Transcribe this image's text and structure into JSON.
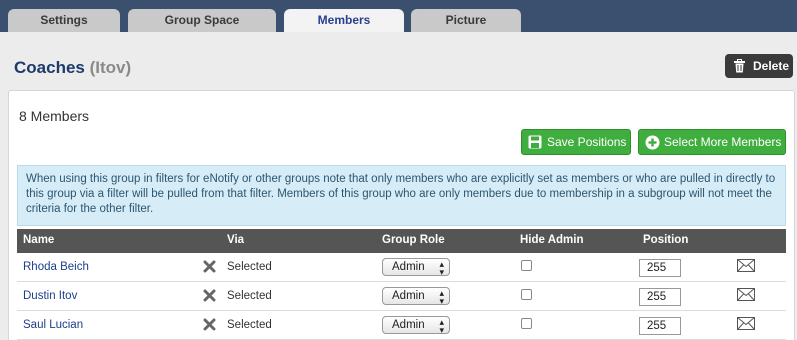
{
  "tabs": [
    {
      "label": "Settings",
      "active": false
    },
    {
      "label": "Group Space",
      "active": false
    },
    {
      "label": "Members",
      "active": true
    },
    {
      "label": "Picture",
      "active": false
    }
  ],
  "header": {
    "title": "Coaches",
    "subtitle": "(Itov)",
    "delete_label": "Delete"
  },
  "panel": {
    "members_count": "8 Members",
    "save_positions_label": "Save Positions",
    "select_more_label": "Select More Members",
    "info_text": "When using this group in filters for eNotify or other groups note that only members who are explicitly set as members or who are pulled in directly to this group via a filter will be pulled from that filter. Members of this group who are only members due to membership in a subgroup will not meet the criteria for the other filter."
  },
  "table": {
    "columns": [
      "Name",
      "Via",
      "Group Role",
      "Hide Admin",
      "Position"
    ],
    "rows": [
      {
        "name": "Rhoda Beich",
        "via": "Selected",
        "role": "Admin",
        "hide_admin": false,
        "position": "255"
      },
      {
        "name": "Dustin Itov",
        "via": "Selected",
        "role": "Admin",
        "hide_admin": false,
        "position": "255"
      },
      {
        "name": "Saul Lucian",
        "via": "Selected",
        "role": "Admin",
        "hide_admin": false,
        "position": "255"
      }
    ]
  },
  "icons": {
    "delete": "trash-icon",
    "save": "floppy-disk-icon",
    "select_more": "plus-circle-icon",
    "remove": "x-icon",
    "message": "envelope-icon"
  },
  "colors": {
    "tab_bar": "#3b4f6e",
    "active_tab_text": "#2a3f8e",
    "green_button": "#3fae3f",
    "info_background": "#d6ecf7",
    "table_header": "#555555",
    "link": "#1d3f8a"
  }
}
